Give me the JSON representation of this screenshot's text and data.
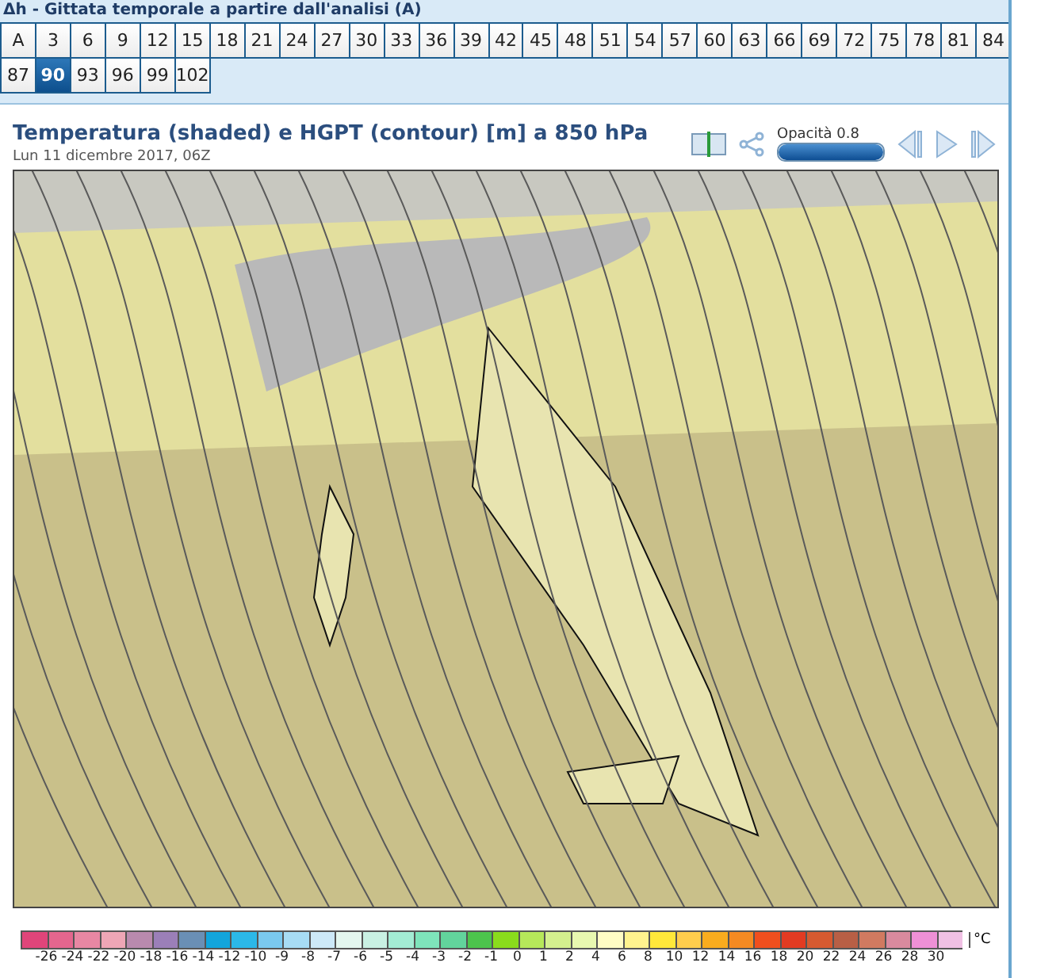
{
  "range_bar": {
    "title": "Δh - Gittata temporale a partire dall'analisi (A)",
    "steps": [
      {
        "label": "A",
        "selected": false
      },
      {
        "label": "3",
        "selected": false
      },
      {
        "label": "6",
        "selected": false
      },
      {
        "label": "9",
        "selected": false
      },
      {
        "label": "12",
        "selected": false
      },
      {
        "label": "15",
        "selected": false
      },
      {
        "label": "18",
        "selected": false
      },
      {
        "label": "21",
        "selected": false
      },
      {
        "label": "24",
        "selected": false
      },
      {
        "label": "27",
        "selected": false
      },
      {
        "label": "30",
        "selected": false
      },
      {
        "label": "33",
        "selected": false
      },
      {
        "label": "36",
        "selected": false
      },
      {
        "label": "39",
        "selected": false
      },
      {
        "label": "42",
        "selected": false
      },
      {
        "label": "45",
        "selected": false
      },
      {
        "label": "48",
        "selected": false
      },
      {
        "label": "51",
        "selected": false
      },
      {
        "label": "54",
        "selected": false
      },
      {
        "label": "57",
        "selected": false
      },
      {
        "label": "60",
        "selected": false
      },
      {
        "label": "63",
        "selected": false
      },
      {
        "label": "66",
        "selected": false
      },
      {
        "label": "69",
        "selected": false
      },
      {
        "label": "72",
        "selected": false
      },
      {
        "label": "75",
        "selected": false
      },
      {
        "label": "78",
        "selected": false
      },
      {
        "label": "81",
        "selected": false
      },
      {
        "label": "84",
        "selected": false
      },
      {
        "label": "87",
        "selected": false
      },
      {
        "label": "90",
        "selected": true
      },
      {
        "label": "93",
        "selected": false
      },
      {
        "label": "96",
        "selected": false
      },
      {
        "label": "99",
        "selected": false
      },
      {
        "label": "102",
        "selected": false
      }
    ]
  },
  "map_panel": {
    "title": "Temperatura (shaded) e HGPT (contour) [m] a 850 hPa",
    "date": "Lun 11 dicembre 2017, 06Z",
    "opacity": {
      "label": "Opacità 0.8",
      "level": 1
    }
  },
  "legend": {
    "unit": "°C",
    "swatches": [
      {
        "color": "#e0457a"
      },
      {
        "color": "#e4668e"
      },
      {
        "color": "#e887a3"
      },
      {
        "color": "#eea6b6"
      },
      {
        "color": "#b98aae"
      },
      {
        "color": "#9b7fb8"
      },
      {
        "color": "#6a8fb5"
      },
      {
        "color": "#12a5dc"
      },
      {
        "color": "#2bb8e8"
      },
      {
        "color": "#7ac9ef"
      },
      {
        "color": "#a7dcf4"
      },
      {
        "color": "#cde9f8"
      },
      {
        "color": "#e4f7ef"
      },
      {
        "color": "#c9f1e3"
      },
      {
        "color": "#a3ecd4"
      },
      {
        "color": "#7ee4bb"
      },
      {
        "color": "#62d49c"
      },
      {
        "color": "#4cc44c"
      },
      {
        "color": "#8adc1c"
      },
      {
        "color": "#b6e85a"
      },
      {
        "color": "#d4f08e"
      },
      {
        "color": "#e8f8b0"
      },
      {
        "color": "#fffcc4"
      },
      {
        "color": "#fff38e"
      },
      {
        "color": "#ffe83a"
      },
      {
        "color": "#ffcd4c"
      },
      {
        "color": "#f9ac1e"
      },
      {
        "color": "#f58a22"
      },
      {
        "color": "#f04f1e"
      },
      {
        "color": "#e23b22"
      },
      {
        "color": "#d65a30"
      },
      {
        "color": "#b85f45"
      },
      {
        "color": "#d17a60"
      },
      {
        "color": "#d98a9e"
      },
      {
        "color": "#ee90d6"
      },
      {
        "color": "#f0c0e4"
      }
    ],
    "labels": [
      "-26",
      "-24",
      "-22",
      "-20",
      "-18",
      "-16",
      "-14",
      "-12",
      "-10",
      "-9",
      "-8",
      "-7",
      "-6",
      "-5",
      "-4",
      "-3",
      "-2",
      "-1",
      "0",
      "1",
      "2",
      "4",
      "6",
      "8",
      "10",
      "12",
      "14",
      "16",
      "18",
      "20",
      "22",
      "24",
      "26",
      "28",
      "30"
    ]
  }
}
